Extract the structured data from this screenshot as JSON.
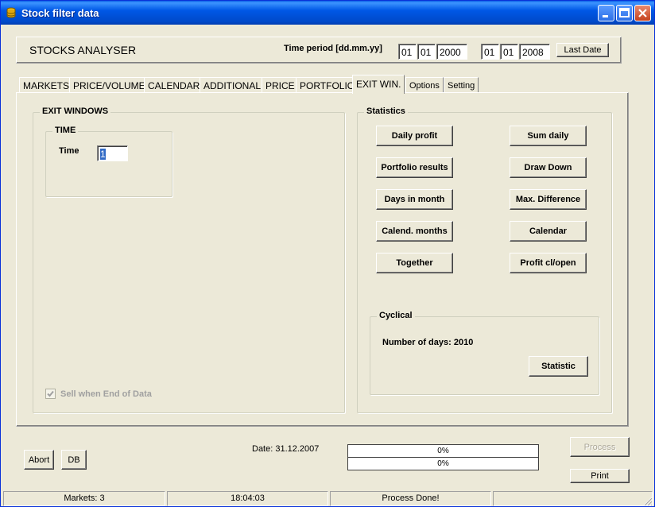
{
  "window": {
    "title": "Stock filter data"
  },
  "header": {
    "app_name": "STOCKS ANALYSER",
    "time_period_label": "Time period [dd.mm.yy]",
    "from": {
      "day": "01",
      "month": "01",
      "year": "2000"
    },
    "to": {
      "day": "01",
      "month": "01",
      "year": "2008"
    },
    "last_date_button": "Last Date"
  },
  "tabs": [
    "MARKETS",
    "PRICE/VOLUME",
    "CALENDAR",
    "ADDITIONAL",
    "PRICE",
    "PORTFOLIO",
    "EXIT WIN.",
    "Options",
    "Setting"
  ],
  "active_tab": "EXIT WIN.",
  "exit_windows": {
    "title": "EXIT WINDOWS",
    "time_group": "TIME",
    "time_label": "Time",
    "time_value": "1",
    "sell_checkbox": "Sell when End of Data",
    "sell_checked": true
  },
  "statistics": {
    "title": "Statistics",
    "buttons": [
      "Daily profit",
      "Sum daily",
      "Portfolio results",
      "Draw Down",
      "Days in month",
      "Max. Difference",
      "Calend. months",
      "Calendar",
      "Together",
      "Profit cl/open"
    ],
    "cyclical": {
      "title": "Cyclical",
      "days_text": "Number of days: 2010",
      "button": "Statistic"
    }
  },
  "bottom": {
    "abort": "Abort",
    "db": "DB",
    "date_text": "Date: 31.12.2007",
    "progress1": "0%",
    "progress2": "0%",
    "process": "Process",
    "print": "Print"
  },
  "statusbar": {
    "markets": "Markets: 3",
    "time": "18:04:03",
    "status": "Process Done!",
    "extra": ""
  }
}
